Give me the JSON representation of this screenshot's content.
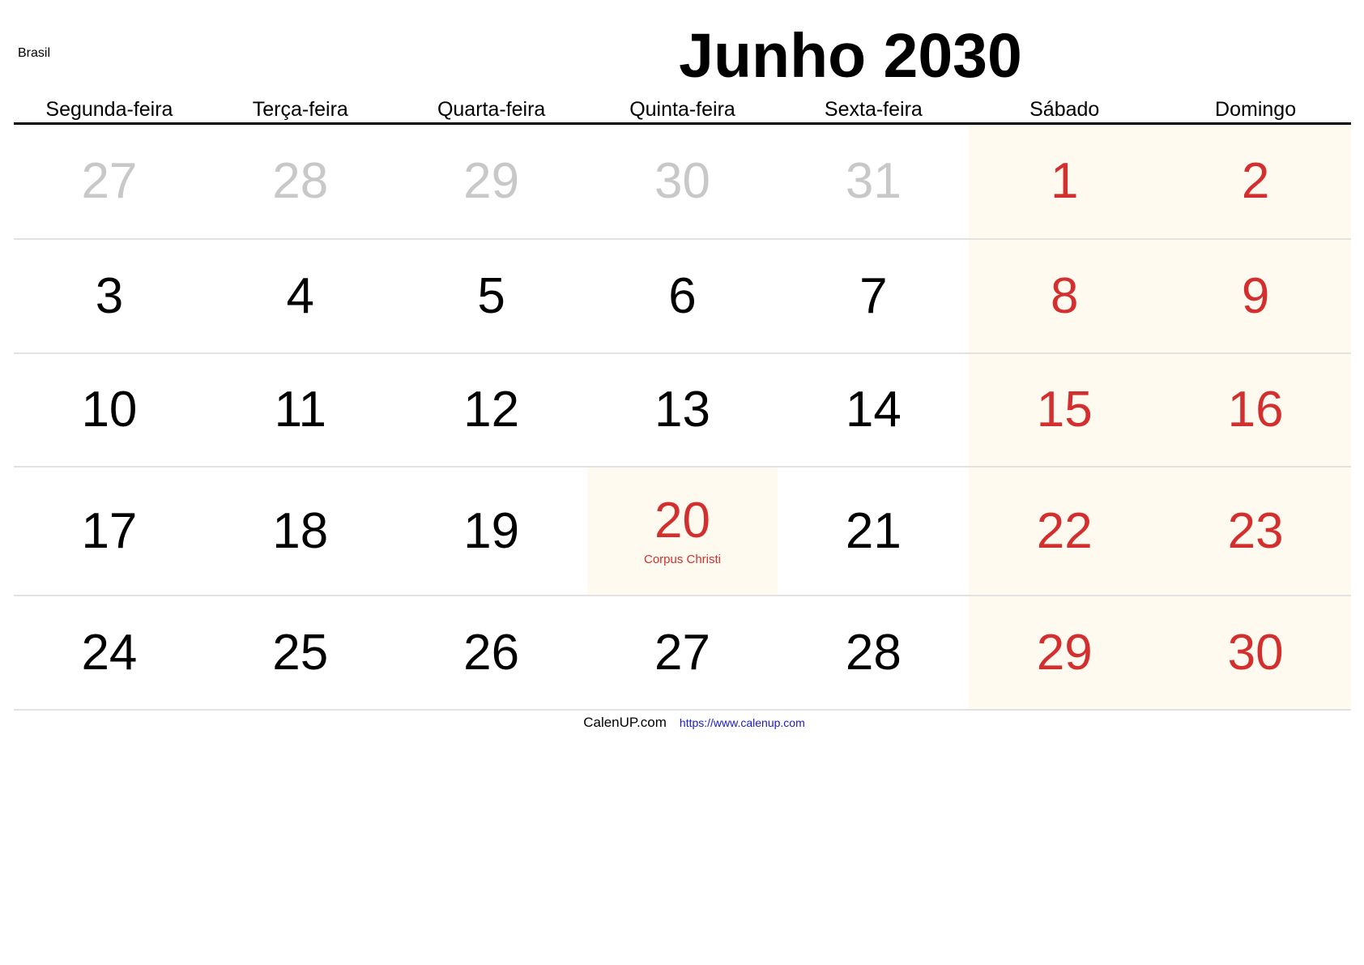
{
  "country": "Brasil",
  "title": "Junho 2030",
  "weekdays": [
    "Segunda-feira",
    "Terça-feira",
    "Quarta-feira",
    "Quinta-feira",
    "Sexta-feira",
    "Sábado",
    "Domingo"
  ],
  "colors": {
    "weekend_text": "#d32f2f",
    "weekend_bg": "#fefaef",
    "other_month": "#c8c8c8",
    "link": "#1a1acc"
  },
  "weeks": [
    [
      {
        "day": "27",
        "type": "other"
      },
      {
        "day": "28",
        "type": "other"
      },
      {
        "day": "29",
        "type": "other"
      },
      {
        "day": "30",
        "type": "other"
      },
      {
        "day": "31",
        "type": "other"
      },
      {
        "day": "1",
        "type": "weekend"
      },
      {
        "day": "2",
        "type": "weekend"
      }
    ],
    [
      {
        "day": "3",
        "type": "normal"
      },
      {
        "day": "4",
        "type": "normal"
      },
      {
        "day": "5",
        "type": "normal"
      },
      {
        "day": "6",
        "type": "normal"
      },
      {
        "day": "7",
        "type": "normal"
      },
      {
        "day": "8",
        "type": "weekend"
      },
      {
        "day": "9",
        "type": "weekend"
      }
    ],
    [
      {
        "day": "10",
        "type": "normal"
      },
      {
        "day": "11",
        "type": "normal"
      },
      {
        "day": "12",
        "type": "normal"
      },
      {
        "day": "13",
        "type": "normal"
      },
      {
        "day": "14",
        "type": "normal"
      },
      {
        "day": "15",
        "type": "weekend"
      },
      {
        "day": "16",
        "type": "weekend"
      }
    ],
    [
      {
        "day": "17",
        "type": "normal"
      },
      {
        "day": "18",
        "type": "normal"
      },
      {
        "day": "19",
        "type": "normal"
      },
      {
        "day": "20",
        "type": "holiday",
        "holiday": "Corpus Christi"
      },
      {
        "day": "21",
        "type": "normal"
      },
      {
        "day": "22",
        "type": "weekend"
      },
      {
        "day": "23",
        "type": "weekend"
      }
    ],
    [
      {
        "day": "24",
        "type": "normal"
      },
      {
        "day": "25",
        "type": "normal"
      },
      {
        "day": "26",
        "type": "normal"
      },
      {
        "day": "27",
        "type": "normal"
      },
      {
        "day": "28",
        "type": "normal"
      },
      {
        "day": "29",
        "type": "weekend"
      },
      {
        "day": "30",
        "type": "weekend"
      }
    ]
  ],
  "footer": {
    "brand": "CalenUP.com",
    "link": "https://www.calenup.com"
  }
}
